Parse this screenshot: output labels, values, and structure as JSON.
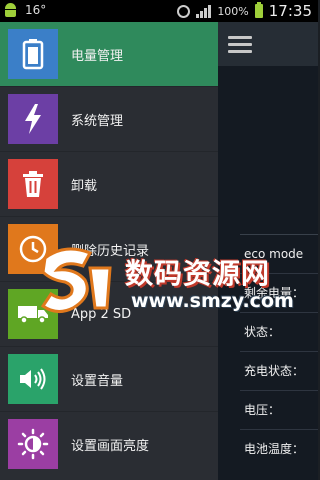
{
  "statusbar": {
    "temperature": "16°",
    "battery": "100%",
    "time": "17:35"
  },
  "drawer": {
    "items": [
      {
        "label": "电量管理",
        "icon": "battery-icon",
        "color": "#3b7fc8"
      },
      {
        "label": "系统管理",
        "icon": "lightning-icon",
        "color": "#6c3fa5"
      },
      {
        "label": "卸载",
        "icon": "trash-icon",
        "color": "#d6413b"
      },
      {
        "label": "删除历史记录",
        "icon": "history-clock-icon",
        "color": "#e0781c"
      },
      {
        "label": "App 2 SD",
        "icon": "truck-icon",
        "color": "#5fa624"
      },
      {
        "label": "设置音量",
        "icon": "speaker-icon",
        "color": "#2aa36a"
      },
      {
        "label": "设置画面亮度",
        "icon": "brightness-icon",
        "color": "#9b3ea3"
      }
    ]
  },
  "main": {
    "info": [
      {
        "label": "eco mode"
      },
      {
        "label": "剩余电量："
      },
      {
        "label": "状态："
      },
      {
        "label": "充电状态："
      },
      {
        "label": "电压："
      },
      {
        "label": "电池温度："
      }
    ]
  },
  "watermark": {
    "title": "数码资源网",
    "url": "www.smzy.com"
  },
  "colors": {
    "active_item": "#2f8a5c",
    "drawer_bg": "#2a2d33",
    "main_bg": "#141a22"
  }
}
